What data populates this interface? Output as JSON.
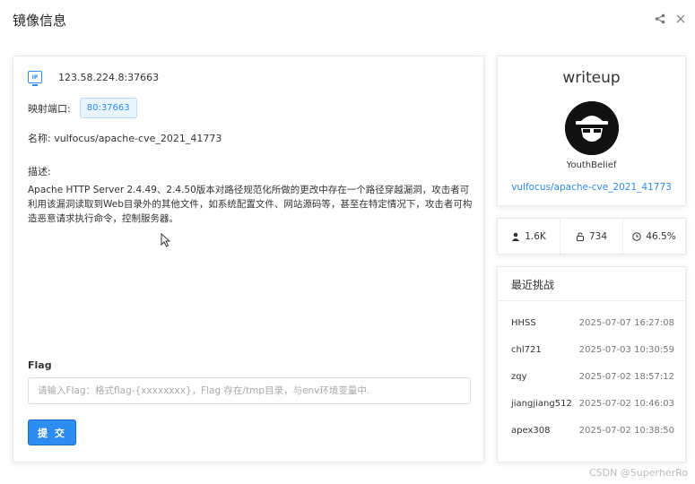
{
  "header": {
    "title": "镜像信息",
    "share_icon": "share-icon",
    "close_icon": "close-icon"
  },
  "info": {
    "ip_icon": "ip-icon",
    "ip_badge": "IP",
    "address": "123.58.224.8:37663",
    "port_label": "映射端口:",
    "port": "80:37663",
    "name": "名称: vulfocus/apache-cve_2021_41773",
    "desc_label": "描述:",
    "desc": "Apache HTTP Server 2.4.49、2.4.50版本对路径规范化所做的更改中存在一个路径穿越漏洞，攻击者可利用该漏洞读取到Web目录外的其他文件，如系统配置文件、网站源码等，甚至在特定情况下，攻击者可构造恶意请求执行命令，控制服务器。"
  },
  "flag": {
    "label": "Flag",
    "placeholder": "请输入Flag：格式flag-{xxxxxxxx}，Flag 存在/tmp目录，与env环境变量中.",
    "value": "",
    "submit_label": "提 交"
  },
  "writeup": {
    "title": "writeup",
    "author": "YouthBelief",
    "link": "vulfocus/apache-cve_2021_41773"
  },
  "stats": {
    "users": "1.6K",
    "solved": "734",
    "rate": "46.5%"
  },
  "recent": {
    "title": "最近挑战",
    "items": [
      {
        "user": "HHSS",
        "time": "2025-07-07 16:27:08"
      },
      {
        "user": "chl721",
        "time": "2025-07-03 10:30:59"
      },
      {
        "user": "zqy",
        "time": "2025-07-02 18:57:12"
      },
      {
        "user": "jiangjiang512",
        "time": "2025-07-02 10:46:03"
      },
      {
        "user": "apex308",
        "time": "2025-07-02 10:38:50"
      }
    ]
  },
  "watermark": "CSDN @SuperherRo",
  "colors": {
    "accent": "#2d8cf0",
    "tag_bg": "#e8f4ff"
  }
}
